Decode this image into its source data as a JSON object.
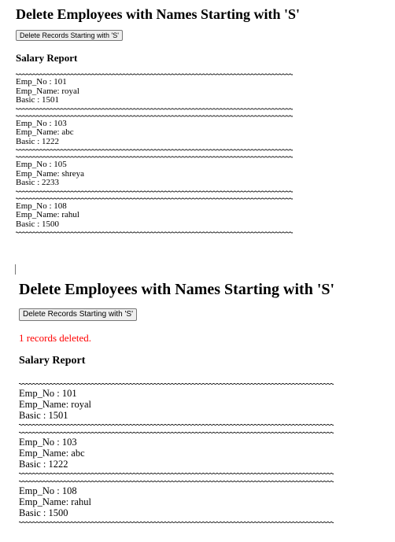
{
  "panels": [
    {
      "title": "Delete Employees with Names Starting with 'S'",
      "button_label": "Delete Records Starting with 'S'",
      "status": "",
      "report_title": "Salary Report",
      "emp_no_label": "Emp_No : ",
      "emp_name_label": "Emp_Name: ",
      "basic_label": "Basic : ",
      "employees": [
        {
          "no": "101",
          "name": "royal",
          "basic": "1501"
        },
        {
          "no": "103",
          "name": "abc",
          "basic": "1222"
        },
        {
          "no": "105",
          "name": "shreya",
          "basic": "2233"
        },
        {
          "no": "108",
          "name": "rahul",
          "basic": "1500"
        }
      ]
    },
    {
      "title": "Delete Employees with Names Starting with 'S'",
      "button_label": "Delete Records Starting with 'S'",
      "status": "1 records deleted.",
      "report_title": "Salary Report",
      "emp_no_label": "Emp_No : ",
      "emp_name_label": "Emp_Name: ",
      "basic_label": "Basic : ",
      "employees": [
        {
          "no": "101",
          "name": "royal",
          "basic": "1501"
        },
        {
          "no": "103",
          "name": "abc",
          "basic": "1222"
        },
        {
          "no": "108",
          "name": "rahul",
          "basic": "1500"
        }
      ]
    }
  ],
  "colors": {
    "status_text": "#ff0000",
    "separator": "#000000"
  }
}
